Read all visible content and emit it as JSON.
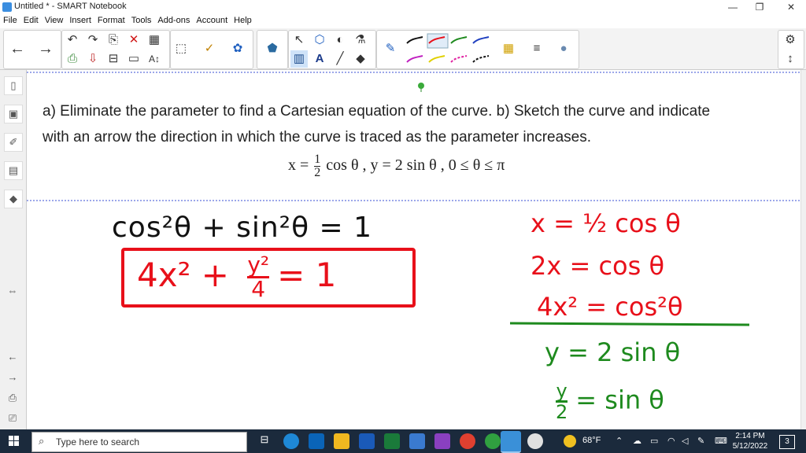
{
  "window": {
    "title": "Untitled * - SMART Notebook",
    "min": "—",
    "max": "❐",
    "close": "✕"
  },
  "menu": [
    "File",
    "Edit",
    "View",
    "Insert",
    "Format",
    "Tools",
    "Add-ons",
    "Account",
    "Help"
  ],
  "toolbar": {
    "nav": [
      "←",
      "→"
    ],
    "edit": [
      "↶",
      "↷",
      "⎘",
      "✕",
      "▦",
      "⎙",
      "⇩",
      "⊟",
      "▭",
      "A↕"
    ],
    "misc": [
      "⬚",
      "✓",
      "✿",
      "⬟"
    ],
    "select": [
      "↖",
      "⬡",
      "◐",
      "⚗",
      "▥",
      "A",
      "╱",
      "◆"
    ],
    "pens": [
      "✎"
    ],
    "right": [
      "⚙",
      "↕"
    ]
  },
  "sidebar": [
    "▯",
    "▣",
    "✐",
    "▤",
    "◆",
    "⇔",
    "←",
    "→",
    "⎙",
    "⎚"
  ],
  "question": {
    "line1": "a) Eliminate the parameter to find a Cartesian equation of the curve. b) Sketch the curve and indicate",
    "line2": "with an arrow the direction in which the curve is traced as the parameter increases.",
    "eq_x": "x =",
    "eq_num": "1",
    "eq_den": "2",
    "eq_rest": "cos θ , y = 2 sin θ , 0 ≤ θ ≤ π"
  },
  "handwriting": {
    "identity": "cos²θ + sin²θ = 1",
    "boxed_left": "4x² + ",
    "boxed_num": "y²",
    "boxed_den": "4",
    "boxed_right": "= 1",
    "right": {
      "l1": "x = ½ cos θ",
      "l2": "2x = cos θ",
      "l3": "4x² = cos²θ",
      "l4": "y = 2 sin θ",
      "l5_num": "y",
      "l5_den": "2",
      "l5_rest": "= sin θ"
    }
  },
  "taskbar": {
    "search_placeholder": "Type here to search",
    "weather": "68°F",
    "time": "2:14 PM",
    "date": "5/12/2022",
    "notif": "3"
  },
  "colors": {
    "ink_black": "#111111",
    "ink_red": "#e8101a",
    "ink_green": "#1e8a1e",
    "page_line": "#3a4fd6"
  }
}
